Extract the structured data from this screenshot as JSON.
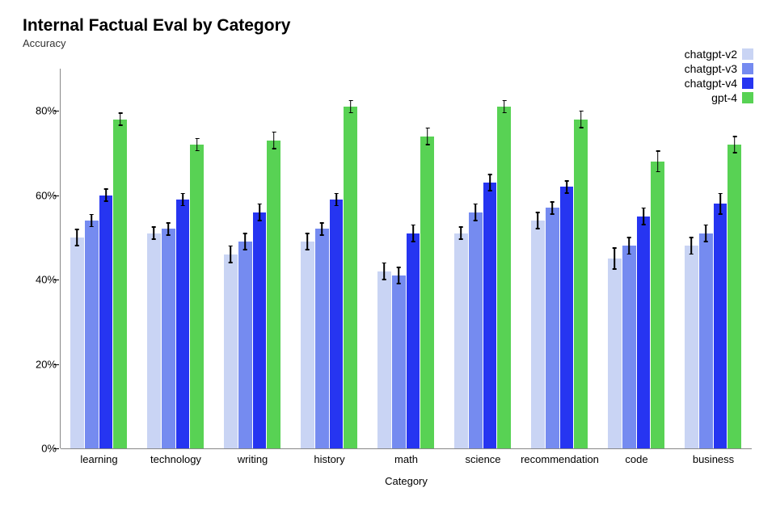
{
  "chart_data": {
    "type": "bar",
    "title": "Internal Factual Eval by Category",
    "subtitle": "Accuracy",
    "xlabel": "Category",
    "ylabel": "",
    "ylim": [
      0,
      90
    ],
    "y_ticks": [
      0,
      20,
      40,
      60,
      80
    ],
    "y_tick_labels": [
      "0%",
      "20%",
      "40%",
      "60%",
      "80%"
    ],
    "categories": [
      "learning",
      "technology",
      "writing",
      "history",
      "math",
      "science",
      "recommendation",
      "code",
      "business"
    ],
    "series": [
      {
        "name": "chatgpt-v2",
        "color": "#c9d4f4",
        "values": [
          50,
          51,
          46,
          49,
          42,
          51,
          54,
          45,
          48
        ],
        "errors": [
          2,
          1.5,
          2,
          2,
          2,
          1.5,
          2,
          2.5,
          2
        ]
      },
      {
        "name": "chatgpt-v3",
        "color": "#758bf0",
        "values": [
          54,
          52,
          49,
          52,
          41,
          56,
          57,
          48,
          51
        ],
        "errors": [
          1.5,
          1.5,
          2,
          1.5,
          2,
          2,
          1.5,
          2,
          2
        ]
      },
      {
        "name": "chatgpt-v4",
        "color": "#2635f1",
        "values": [
          60,
          59,
          56,
          59,
          51,
          63,
          62,
          55,
          58
        ],
        "errors": [
          1.5,
          1.5,
          2,
          1.5,
          2,
          2,
          1.5,
          2,
          2.5
        ]
      },
      {
        "name": "gpt-4",
        "color": "#58d254",
        "values": [
          78,
          72,
          73,
          81,
          74,
          81,
          78,
          68,
          72
        ],
        "errors": [
          1.5,
          1.5,
          2,
          1.5,
          2,
          1.5,
          2,
          2.5,
          2
        ]
      }
    ],
    "legend_position": "top-right"
  }
}
